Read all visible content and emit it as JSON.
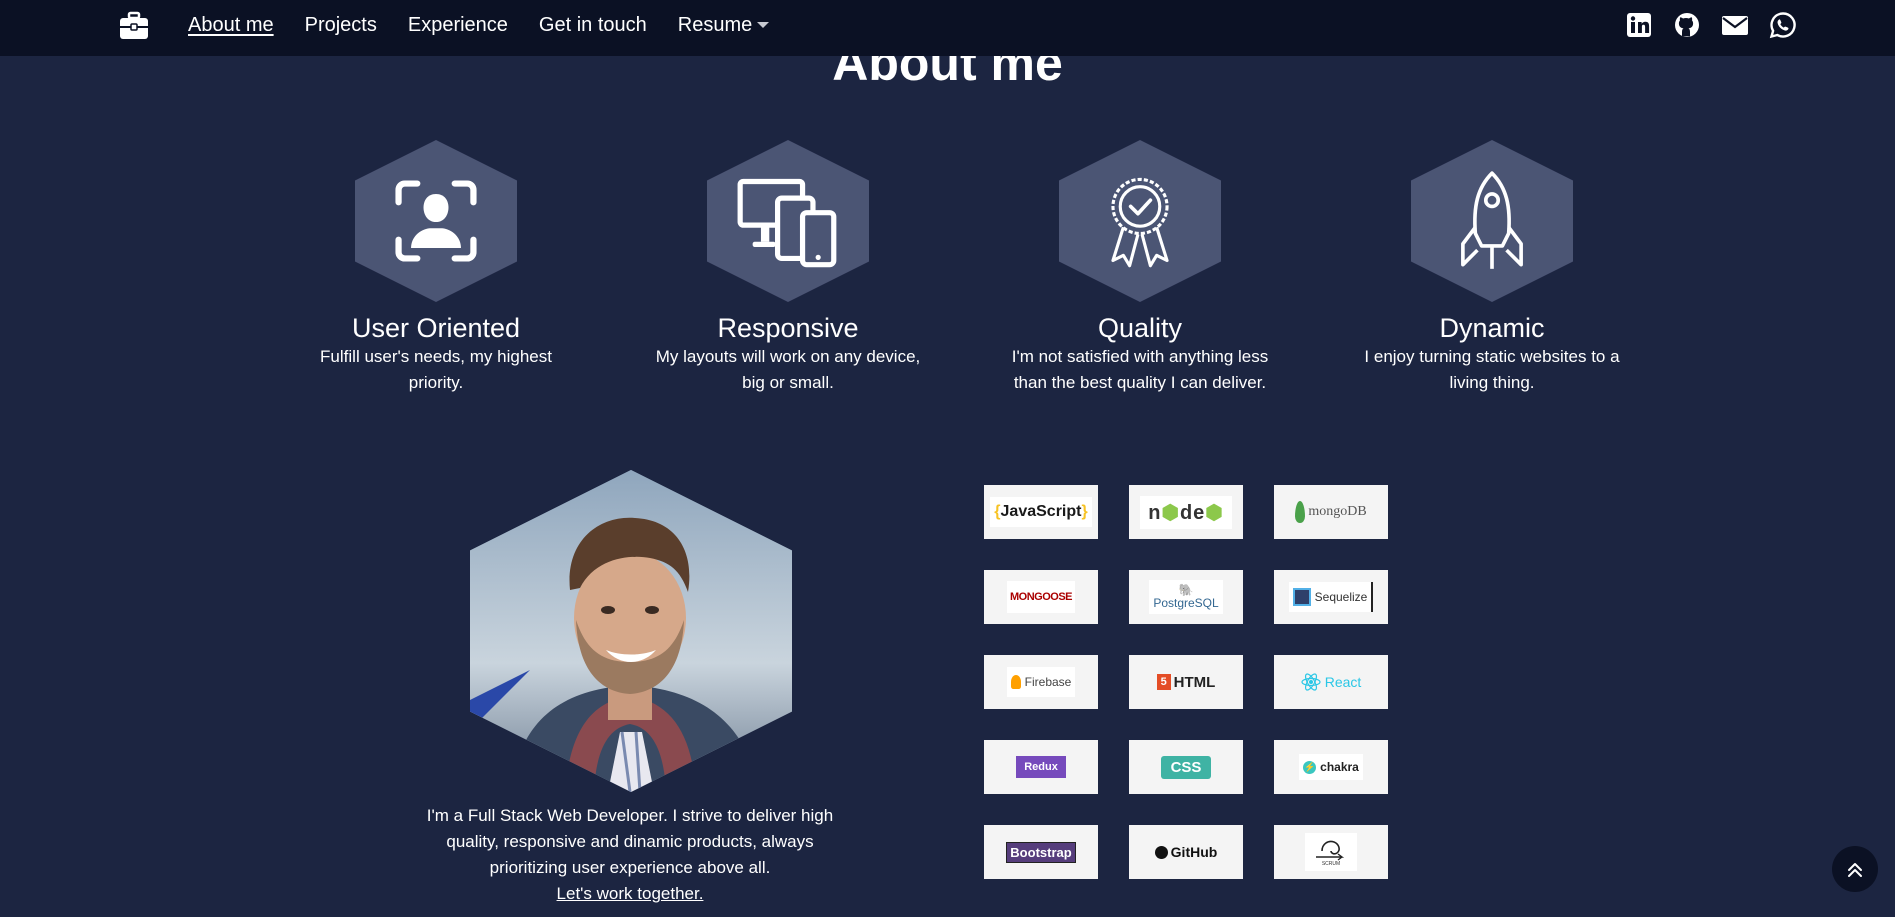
{
  "nav": {
    "brand_icon": "briefcase-icon",
    "links": [
      {
        "label": "About me",
        "active": true
      },
      {
        "label": "Projects"
      },
      {
        "label": "Experience"
      },
      {
        "label": "Get in touch"
      },
      {
        "label": "Resume",
        "dropdown": true
      }
    ],
    "social_icons": [
      "linkedin-icon",
      "github-icon",
      "email-icon",
      "whatsapp-icon"
    ]
  },
  "page": {
    "title": "About me"
  },
  "features": [
    {
      "icon": "user-focus-icon",
      "title": "User Oriented",
      "desc": "Fulfill user's needs, my highest priority."
    },
    {
      "icon": "devices-icon",
      "title": "Responsive",
      "desc": "My layouts will work on any device, big or small."
    },
    {
      "icon": "award-icon",
      "title": "Quality",
      "desc": "I'm not satisfied with anything less than the best quality I can deliver."
    },
    {
      "icon": "rocket-icon",
      "title": "Dynamic",
      "desc": "I enjoy turning static websites to a living thing."
    }
  ],
  "profile": {
    "bio": "I'm a Full Stack Web Developer. I strive to deliver high quality, responsive and dinamic products, always prioritizing user experience above all.",
    "cta": "Let's work together."
  },
  "tech": {
    "javascript": {
      "open": "{",
      "name": "JavaScript",
      "close": "}"
    },
    "node": {
      "a": "n",
      "b": "de",
      "c": "⬢"
    },
    "mongodb": "mongoDB",
    "mongoose": "MONGOOSE",
    "postgresql": "PostgreSQL",
    "sequelize": "Sequelize",
    "firebase": "Firebase",
    "html": "HTML",
    "html_badge": "5",
    "react": "React",
    "redux": "Redux",
    "css": "CSS",
    "chakra": "chakra",
    "bootstrap": "Bootstrap",
    "github": "GitHub",
    "scrum_caption": "SCRUM"
  },
  "colors": {
    "background": "#1c2541",
    "navbar": "#0b1124",
    "hexagon": "#4b5574"
  },
  "scroll_top_icon": "double-chevron-up-icon"
}
